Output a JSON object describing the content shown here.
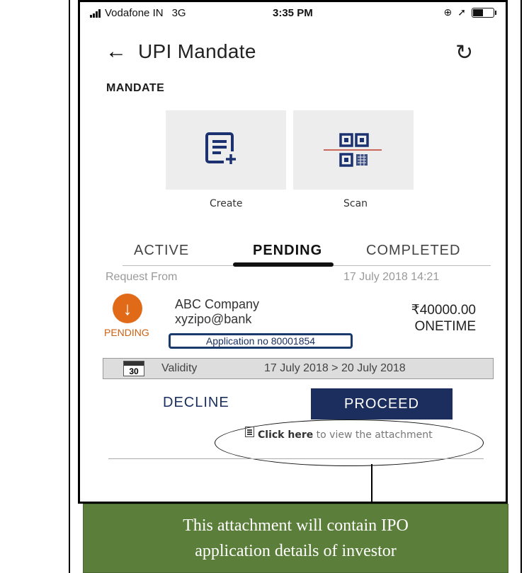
{
  "status_bar": {
    "carrier": "Vodafone IN",
    "network": "3G",
    "time": "3:35 PM",
    "icons": [
      "signal-icon",
      "alarm-icon",
      "location-icon",
      "battery-icon"
    ]
  },
  "header": {
    "title": "UPI Mandate",
    "back_icon": "arrow-left-icon",
    "refresh_icon": "refresh-icon"
  },
  "section_title": "MANDATE",
  "actions": [
    {
      "label": "Create",
      "icon": "document-plus-icon"
    },
    {
      "label": "Scan",
      "icon": "qr-code-icon"
    }
  ],
  "tabs": [
    {
      "label": "ACTIVE",
      "selected": false
    },
    {
      "label": "PENDING",
      "selected": true
    },
    {
      "label": "COMPLETED",
      "selected": false
    }
  ],
  "request": {
    "from_label": "Request From",
    "datetime": "17 July 2018 14:21",
    "company": "ABC Company",
    "upi_id": "xyzipo@bank",
    "amount": "₹40000.00",
    "frequency": "ONETIME",
    "status": "PENDING",
    "application": "Application no 80001854"
  },
  "validity": {
    "calendar_number": "30",
    "label": "Validity",
    "range": "17 July 2018 > 20 July 2018"
  },
  "buttons": {
    "decline": "DECLINE",
    "proceed": "PROCEED"
  },
  "attachment": {
    "link_bold": "Click here",
    "link_rest": " to view the attachment"
  },
  "callout": {
    "line1": "This attachment will contain IPO",
    "line2": "application details of investor"
  },
  "colors": {
    "accent_navy": "#1b2e5e",
    "pending_orange": "#e06a18",
    "callout_green": "#5b7f3a"
  }
}
